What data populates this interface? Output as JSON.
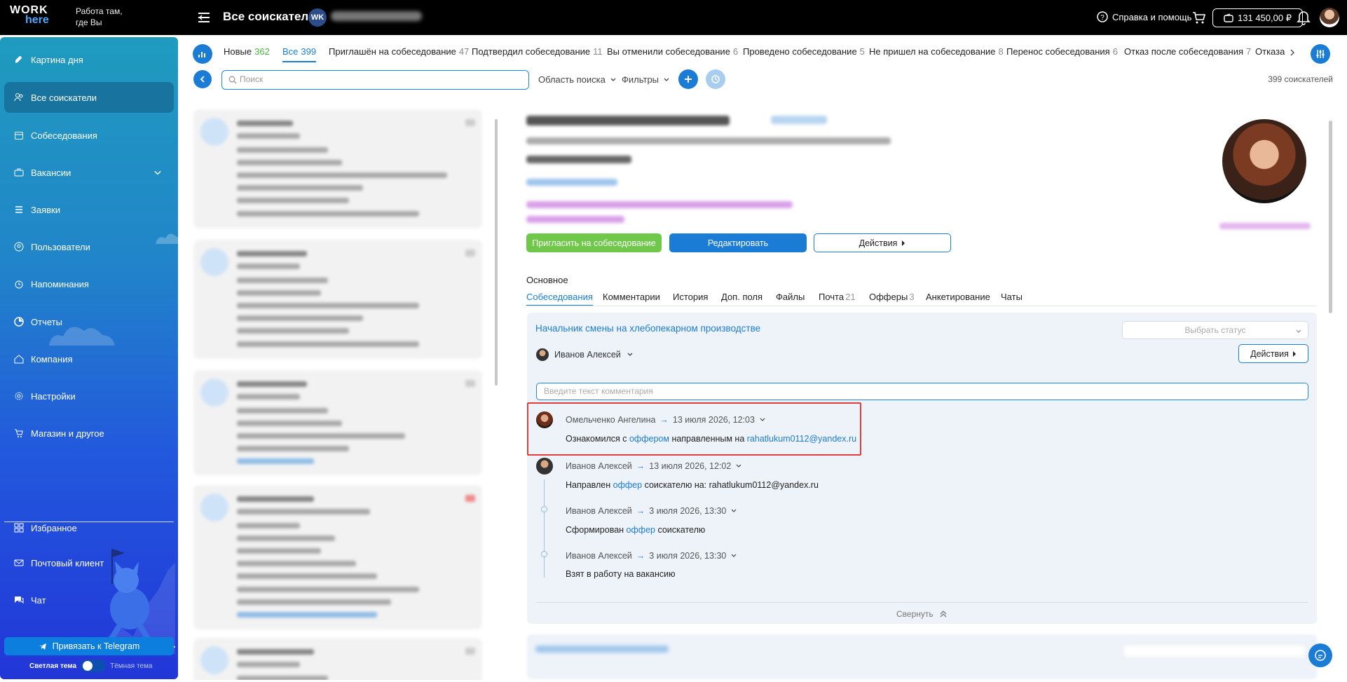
{
  "header": {
    "logo_line1": "WORK",
    "logo_line2": "here",
    "tagline_1": "Работа там,",
    "tagline_2": "где Вы",
    "title": "Все соискатели",
    "avatar_initials": "WK",
    "help": "Справка и помощь",
    "balance": "131 450,00 ₽"
  },
  "sidebar": {
    "items": [
      {
        "label": "Картина дня",
        "icon": "rocket-icon"
      },
      {
        "label": "Все соискатели",
        "icon": "users-icon"
      },
      {
        "label": "Собеседования",
        "icon": "calendar-icon"
      },
      {
        "label": "Вакансии",
        "icon": "briefcase-icon"
      },
      {
        "label": "Заявки",
        "icon": "list-icon"
      },
      {
        "label": "Пользователи",
        "icon": "user-circle-icon"
      },
      {
        "label": "Напоминания",
        "icon": "alarm-icon"
      },
      {
        "label": "Отчеты",
        "icon": "pie-icon"
      },
      {
        "label": "Компания",
        "icon": "home-icon"
      },
      {
        "label": "Настройки",
        "icon": "gear-icon"
      },
      {
        "label": "Магазин и другое",
        "icon": "cart-icon"
      },
      {
        "label": "Избранное",
        "icon": "grid-icon"
      },
      {
        "label": "Почтовый клиент",
        "icon": "mail-icon"
      },
      {
        "label": "Чат",
        "icon": "chat-icon"
      }
    ],
    "telegram_button": "Привязать к Telegram",
    "theme_light": "Светлая тема",
    "theme_dark": "Тёмная тема"
  },
  "status_tabs": [
    {
      "label": "Новые",
      "count": "362"
    },
    {
      "label": "Все",
      "count": "399"
    },
    {
      "label": "Приглашён на собеседование",
      "count": "47"
    },
    {
      "label": "Подтвердил собеседование",
      "count": "11"
    },
    {
      "label": "Вы отменили собеседование",
      "count": "6"
    },
    {
      "label": "Проведено собеседование",
      "count": "5"
    },
    {
      "label": "Не пришел на собеседование",
      "count": "8"
    },
    {
      "label": "Перенос собеседования",
      "count": "6"
    },
    {
      "label": "Отказ после собеседования",
      "count": "7"
    },
    {
      "label": "Отказал",
      "count": ""
    }
  ],
  "toolbar": {
    "search_placeholder": "Поиск",
    "search_area": "Область поиска",
    "filters": "Фильтры",
    "total": "399 соискателей"
  },
  "candidate": {
    "invite_button": "Пригласить на собеседование",
    "edit_button": "Редактировать",
    "actions_button": "Действия"
  },
  "detail_tabs": {
    "section": "Основное",
    "tabs": [
      {
        "label": "Собеседования",
        "count": ""
      },
      {
        "label": "Комментарии",
        "count": ""
      },
      {
        "label": "История",
        "count": ""
      },
      {
        "label": "Доп. поля",
        "count": ""
      },
      {
        "label": "Файлы",
        "count": ""
      },
      {
        "label": "Почта",
        "count": "21"
      },
      {
        "label": "Офферы",
        "count": "3"
      },
      {
        "label": "Анкетирование",
        "count": ""
      },
      {
        "label": "Чаты",
        "count": ""
      }
    ]
  },
  "interview": {
    "vacancy": "Начальник смены на хлебопекарном производстве",
    "status_placeholder": "Выбрать статус",
    "owner": "Иванов Алексей",
    "actions": "Действия",
    "comment_placeholder": "Введите текст комментария",
    "collapse": "Свернуть",
    "events": [
      {
        "author": "Омельченко Ангелина",
        "date": "13 июля 2026, 12:03",
        "pre": "Ознакомился с",
        "link": "оффером",
        "mid": "направленным на",
        "email": "rahatlukum0112@yandex.ru"
      },
      {
        "author": "Иванов Алексей",
        "date": "13 июля 2026, 12:02",
        "pre": "Направлен",
        "link": "оффер",
        "post": "соискателю на: rahatlukum0112@yandex.ru"
      },
      {
        "author": "Иванов Алексей",
        "date": "3 июля 2026, 13:30",
        "pre": "Сформирован",
        "link": "оффер",
        "post": "соискателю"
      },
      {
        "author": "Иванов Алексей",
        "date": "3 июля 2026, 13:30",
        "text": "Взят в работу на вакансию"
      }
    ]
  }
}
